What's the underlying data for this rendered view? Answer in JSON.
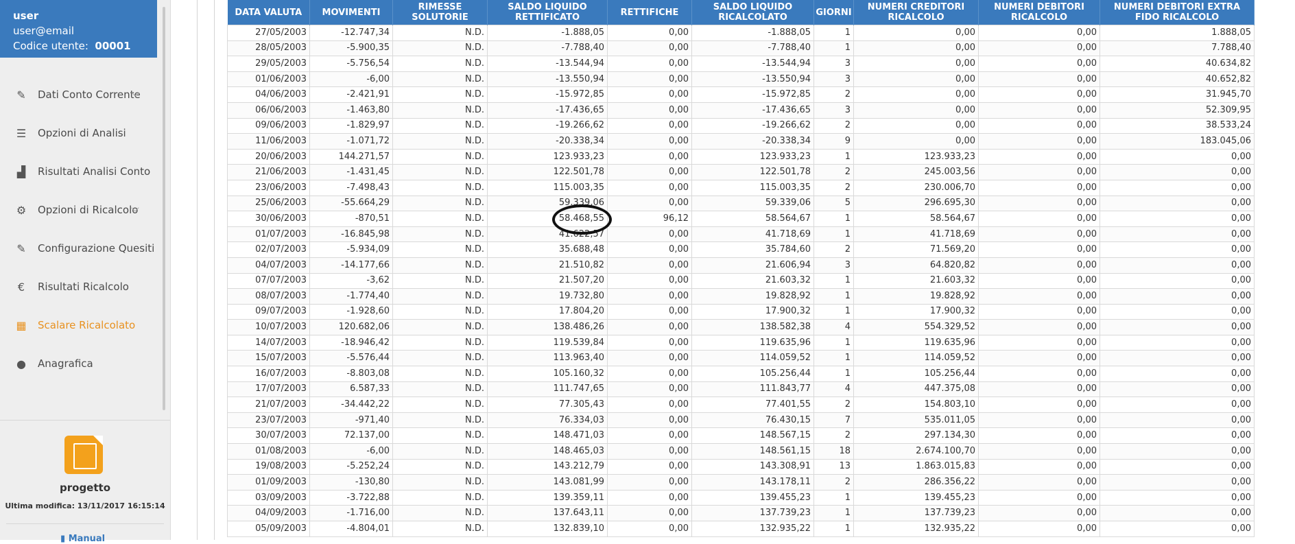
{
  "user": {
    "name": "user",
    "email": "user@email",
    "code_label": "Codice utente:",
    "code_value": "00001"
  },
  "nav": [
    {
      "label": "Dati Conto Corrente",
      "icon": "edit-icon",
      "glyph": "✎",
      "chevron": true,
      "active": false
    },
    {
      "label": "Opzioni di Analisi",
      "icon": "sliders-icon",
      "glyph": "☰",
      "chevron": false,
      "active": false
    },
    {
      "label": "Risultati Analisi Conto",
      "icon": "bar-chart-icon",
      "glyph": "▟",
      "chevron": false,
      "active": false
    },
    {
      "label": "Opzioni di Ricalcolo",
      "icon": "gears-icon",
      "glyph": "⚙",
      "chevron": true,
      "active": false
    },
    {
      "label": "Configurazione Quesiti",
      "icon": "edit-icon",
      "glyph": "✎",
      "chevron": false,
      "active": false
    },
    {
      "label": "Risultati Ricalcolo",
      "icon": "euro-icon",
      "glyph": "€",
      "chevron": false,
      "active": false
    },
    {
      "label": "Scalare Ricalcolato",
      "icon": "table-icon",
      "glyph": "▦",
      "chevron": false,
      "active": true
    },
    {
      "label": "Anagrafica",
      "icon": "user-icon",
      "glyph": "●",
      "chevron": false,
      "active": false
    }
  ],
  "project": {
    "name": "progetto",
    "last_modified": "Ultima modifica: 13/11/2017 16:15:14",
    "cut_text": "Manual"
  },
  "table": {
    "headers": [
      "DATA VALUTA",
      "MOVIMENTI",
      "RIMESSE SOLUTORIE",
      "SALDO LIQUIDO RETTIFICATO",
      "RETTIFICHE",
      "SALDO LIQUIDO RICALCOLATO",
      "GIORNI",
      "NUMERI CREDITORI RICALCOLO",
      "NUMERI DEBITORI RICALCOLO",
      "NUMERI DEBITORI EXTRA FIDO RICALCOLO"
    ],
    "rows": [
      [
        "27/05/2003",
        "-12.747,34",
        "N.D.",
        "-1.888,05",
        "0,00",
        "-1.888,05",
        "1",
        "0,00",
        "0,00",
        "1.888,05"
      ],
      [
        "28/05/2003",
        "-5.900,35",
        "N.D.",
        "-7.788,40",
        "0,00",
        "-7.788,40",
        "1",
        "0,00",
        "0,00",
        "7.788,40"
      ],
      [
        "29/05/2003",
        "-5.756,54",
        "N.D.",
        "-13.544,94",
        "0,00",
        "-13.544,94",
        "3",
        "0,00",
        "0,00",
        "40.634,82"
      ],
      [
        "01/06/2003",
        "-6,00",
        "N.D.",
        "-13.550,94",
        "0,00",
        "-13.550,94",
        "3",
        "0,00",
        "0,00",
        "40.652,82"
      ],
      [
        "04/06/2003",
        "-2.421,91",
        "N.D.",
        "-15.972,85",
        "0,00",
        "-15.972,85",
        "2",
        "0,00",
        "0,00",
        "31.945,70"
      ],
      [
        "06/06/2003",
        "-1.463,80",
        "N.D.",
        "-17.436,65",
        "0,00",
        "-17.436,65",
        "3",
        "0,00",
        "0,00",
        "52.309,95"
      ],
      [
        "09/06/2003",
        "-1.829,97",
        "N.D.",
        "-19.266,62",
        "0,00",
        "-19.266,62",
        "2",
        "0,00",
        "0,00",
        "38.533,24"
      ],
      [
        "11/06/2003",
        "-1.071,72",
        "N.D.",
        "-20.338,34",
        "0,00",
        "-20.338,34",
        "9",
        "0,00",
        "0,00",
        "183.045,06"
      ],
      [
        "20/06/2003",
        "144.271,57",
        "N.D.",
        "123.933,23",
        "0,00",
        "123.933,23",
        "1",
        "123.933,23",
        "0,00",
        "0,00"
      ],
      [
        "21/06/2003",
        "-1.431,45",
        "N.D.",
        "122.501,78",
        "0,00",
        "122.501,78",
        "2",
        "245.003,56",
        "0,00",
        "0,00"
      ],
      [
        "23/06/2003",
        "-7.498,43",
        "N.D.",
        "115.003,35",
        "0,00",
        "115.003,35",
        "2",
        "230.006,70",
        "0,00",
        "0,00"
      ],
      [
        "25/06/2003",
        "-55.664,29",
        "N.D.",
        "59.339,06",
        "0,00",
        "59.339,06",
        "5",
        "296.695,30",
        "0,00",
        "0,00"
      ],
      [
        "30/06/2003",
        "-870,51",
        "N.D.",
        "58.468,55",
        "96,12",
        "58.564,67",
        "1",
        "58.564,67",
        "0,00",
        "0,00"
      ],
      [
        "01/07/2003",
        "-16.845,98",
        "N.D.",
        "41.622,57",
        "0,00",
        "41.718,69",
        "1",
        "41.718,69",
        "0,00",
        "0,00"
      ],
      [
        "02/07/2003",
        "-5.934,09",
        "N.D.",
        "35.688,48",
        "0,00",
        "35.784,60",
        "2",
        "71.569,20",
        "0,00",
        "0,00"
      ],
      [
        "04/07/2003",
        "-14.177,66",
        "N.D.",
        "21.510,82",
        "0,00",
        "21.606,94",
        "3",
        "64.820,82",
        "0,00",
        "0,00"
      ],
      [
        "07/07/2003",
        "-3,62",
        "N.D.",
        "21.507,20",
        "0,00",
        "21.603,32",
        "1",
        "21.603,32",
        "0,00",
        "0,00"
      ],
      [
        "08/07/2003",
        "-1.774,40",
        "N.D.",
        "19.732,80",
        "0,00",
        "19.828,92",
        "1",
        "19.828,92",
        "0,00",
        "0,00"
      ],
      [
        "09/07/2003",
        "-1.928,60",
        "N.D.",
        "17.804,20",
        "0,00",
        "17.900,32",
        "1",
        "17.900,32",
        "0,00",
        "0,00"
      ],
      [
        "10/07/2003",
        "120.682,06",
        "N.D.",
        "138.486,26",
        "0,00",
        "138.582,38",
        "4",
        "554.329,52",
        "0,00",
        "0,00"
      ],
      [
        "14/07/2003",
        "-18.946,42",
        "N.D.",
        "119.539,84",
        "0,00",
        "119.635,96",
        "1",
        "119.635,96",
        "0,00",
        "0,00"
      ],
      [
        "15/07/2003",
        "-5.576,44",
        "N.D.",
        "113.963,40",
        "0,00",
        "114.059,52",
        "1",
        "114.059,52",
        "0,00",
        "0,00"
      ],
      [
        "16/07/2003",
        "-8.803,08",
        "N.D.",
        "105.160,32",
        "0,00",
        "105.256,44",
        "1",
        "105.256,44",
        "0,00",
        "0,00"
      ],
      [
        "17/07/2003",
        "6.587,33",
        "N.D.",
        "111.747,65",
        "0,00",
        "111.843,77",
        "4",
        "447.375,08",
        "0,00",
        "0,00"
      ],
      [
        "21/07/2003",
        "-34.442,22",
        "N.D.",
        "77.305,43",
        "0,00",
        "77.401,55",
        "2",
        "154.803,10",
        "0,00",
        "0,00"
      ],
      [
        "23/07/2003",
        "-971,40",
        "N.D.",
        "76.334,03",
        "0,00",
        "76.430,15",
        "7",
        "535.011,05",
        "0,00",
        "0,00"
      ],
      [
        "30/07/2003",
        "72.137,00",
        "N.D.",
        "148.471,03",
        "0,00",
        "148.567,15",
        "2",
        "297.134,30",
        "0,00",
        "0,00"
      ],
      [
        "01/08/2003",
        "-6,00",
        "N.D.",
        "148.465,03",
        "0,00",
        "148.561,15",
        "18",
        "2.674.100,70",
        "0,00",
        "0,00"
      ],
      [
        "19/08/2003",
        "-5.252,24",
        "N.D.",
        "143.212,79",
        "0,00",
        "143.308,91",
        "13",
        "1.863.015,83",
        "0,00",
        "0,00"
      ],
      [
        "01/09/2003",
        "-130,80",
        "N.D.",
        "143.081,99",
        "0,00",
        "143.178,11",
        "2",
        "286.356,22",
        "0,00",
        "0,00"
      ],
      [
        "03/09/2003",
        "-3.722,88",
        "N.D.",
        "139.359,11",
        "0,00",
        "139.455,23",
        "1",
        "139.455,23",
        "0,00",
        "0,00"
      ],
      [
        "04/09/2003",
        "-1.716,00",
        "N.D.",
        "137.643,11",
        "0,00",
        "137.739,23",
        "1",
        "137.739,23",
        "0,00",
        "0,00"
      ],
      [
        "05/09/2003",
        "-4.804,01",
        "N.D.",
        "132.839,10",
        "0,00",
        "132.935,22",
        "1",
        "132.935,22",
        "0,00",
        "0,00"
      ]
    ]
  },
  "colors": {
    "header_bg": "#3a7abd",
    "active_nav": "#e8911f",
    "logo": "#f3a11c"
  }
}
